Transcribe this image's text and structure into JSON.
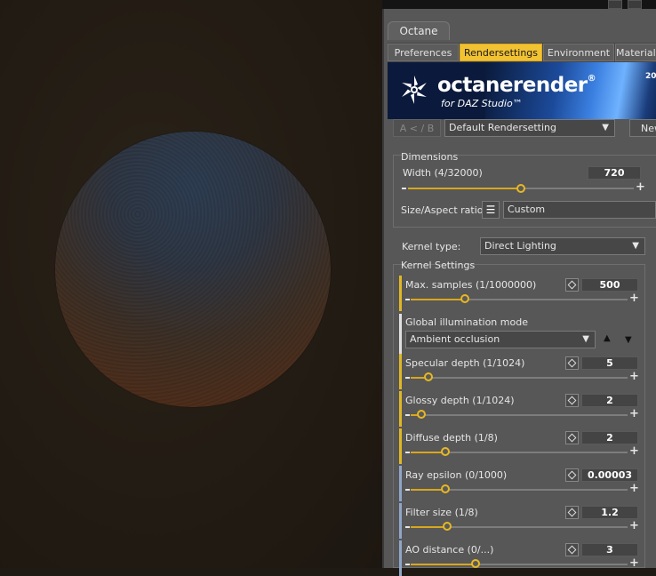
{
  "window": {
    "title_tab": "Octane"
  },
  "tabs": [
    {
      "label": "Preferences"
    },
    {
      "label": "Rendersettings"
    },
    {
      "label": "Environment"
    },
    {
      "label": "Materials"
    }
  ],
  "banner": {
    "brand": "octanerender",
    "reg": "®",
    "sub": "for DAZ Studio™",
    "year": "20"
  },
  "toolbar": {
    "ab_label": "A < / B",
    "preset_value": "Default Rendersetting",
    "new_label": "New"
  },
  "dimensions": {
    "title": "Dimensions",
    "width_label": "Width (4/32000)",
    "width_value": "720",
    "width_fraction": 0.5,
    "aspect_label": "Size/Aspect ratio:",
    "aspect_value": "Custom"
  },
  "kernel": {
    "type_label": "Kernel type:",
    "type_value": "Direct Lighting",
    "settings_title": "Kernel Settings"
  },
  "params": [
    {
      "label": "Max. samples (1/1000000)",
      "value": "500",
      "fraction": 0.25,
      "color": "#e1b823"
    },
    {
      "label": "Specular depth (1/1024)",
      "value": "5",
      "fraction": 0.08,
      "color": "#e1b823"
    },
    {
      "label": "Glossy depth (1/1024)",
      "value": "2",
      "fraction": 0.05,
      "color": "#e1b823"
    },
    {
      "label": "Diffuse depth (1/8)",
      "value": "2",
      "fraction": 0.16,
      "color": "#e1b823"
    },
    {
      "label": "Ray epsilon (0/1000)",
      "value": "0.00003",
      "fraction": 0.16,
      "color": "#8fa6c8"
    },
    {
      "label": "Filter size (1/8)",
      "value": "1.2",
      "fraction": 0.17,
      "color": "#8fa6c8"
    },
    {
      "label": "AO distance (0/...)",
      "value": "3",
      "fraction": 0.3,
      "color": "#8fa6c8"
    }
  ],
  "gi": {
    "label": "Global illumination mode",
    "value": "Ambient occlusion"
  },
  "colors": {
    "accent": "#f1c232",
    "panel": "#575757"
  }
}
